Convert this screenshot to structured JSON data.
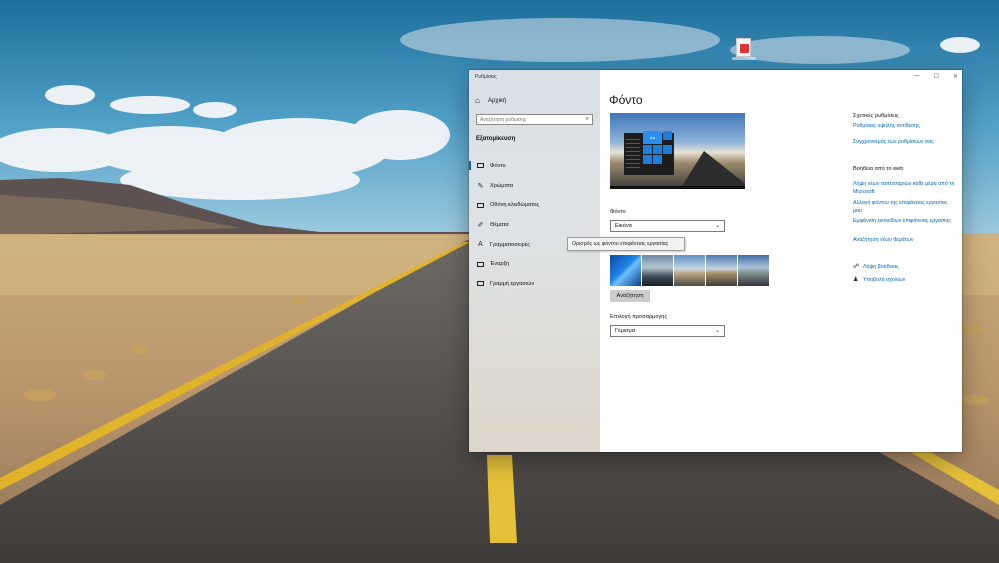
{
  "window": {
    "app_title": "Ρυθμίσεις",
    "controls": {
      "minimize": "—",
      "maximize": "☐",
      "close": "✕"
    }
  },
  "sidebar": {
    "home": {
      "icon": "home-icon",
      "glyph": "⌂",
      "label": "Αρχική"
    },
    "search": {
      "placeholder": "Αναζήτηση ρύθμισης",
      "icon": "search-icon",
      "glyph": "⌕"
    },
    "section": "Εξατομίκευση",
    "items": [
      {
        "label": "Φόντο",
        "icon": "picture-icon",
        "active": true
      },
      {
        "label": "Χρώματα",
        "icon": "palette-icon",
        "glyph": "✎"
      },
      {
        "label": "Οθόνη κλειδώματος",
        "icon": "lock-screen-icon"
      },
      {
        "label": "Θέματα",
        "icon": "brush-icon",
        "glyph": "✐"
      },
      {
        "label": "Γραμματοσειρές",
        "icon": "font-icon",
        "glyph": "A"
      },
      {
        "label": "Έναρξη",
        "icon": "start-icon"
      },
      {
        "label": "Γραμμή εργασιών",
        "icon": "taskbar-icon"
      }
    ]
  },
  "tooltip": {
    "text": "Ορισμός ως φόντου επιφάνειας εργασίας"
  },
  "main": {
    "title": "Φόντο",
    "preview": {
      "tile_label": "Aa"
    },
    "background_label": "Φόντο",
    "background_value": "Εικόνα",
    "browse_label": "Αναζήτηση",
    "fit_label": "Επιλογή προσαρμογής",
    "fit_value": "Γέμισμα"
  },
  "right": {
    "related_head": "Σχετικές ρυθμίσεις",
    "related_links": [
      "Ρυθμίσεις υψηλής αντίθεσης",
      "Συγχρονισμός των ρυθμίσεών σας"
    ],
    "web_head": "Βοήθεια από το web",
    "web_links": [
      "Λήψη νέων ταπετσαριών κάθε μέρα από τη Microsoft",
      "Αλλαγή φόντου της επιφάνειας εργασίας μου",
      "Εμφάνιση εικονιδίων επιφάνειας εργασίας",
      "Αναζήτηση νέων θεμάτων"
    ],
    "help": {
      "label": "Λήψη βοήθειας",
      "icon": "help-chat-icon"
    },
    "feedback": {
      "label": "Υποβολή σχολίων",
      "icon": "feedback-icon"
    }
  },
  "colors": {
    "accent": "#0067b8",
    "tile_blue": "#1b7fe0"
  }
}
